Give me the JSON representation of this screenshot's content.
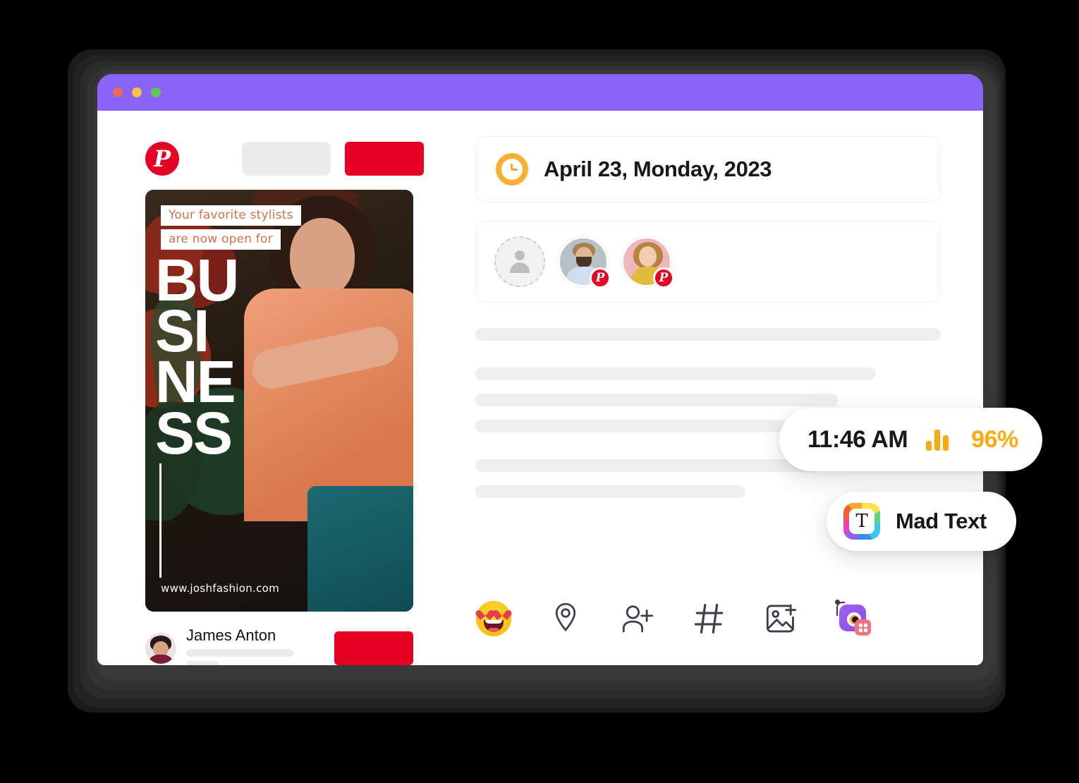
{
  "window": {
    "titlebar_color": "#8A64FA",
    "traffic_lights": [
      "close",
      "minimize",
      "maximize"
    ]
  },
  "left_panel": {
    "brand": {
      "icon": "pinterest-logo-icon",
      "glyph": "P"
    },
    "toolbar_buttons": [
      {
        "name": "search-placeholder-button",
        "color": "#ECECEC"
      },
      {
        "name": "primary-action-button",
        "color": "#E60023"
      }
    ],
    "poster": {
      "caption_line1": "Your favorite stylists",
      "caption_line2": "are now open for",
      "title_lines": [
        "BU",
        "SI",
        "NE",
        "SS"
      ],
      "url": "www.joshfashion.com",
      "caption_color": "#D4704F"
    },
    "author": {
      "name": "James Anton",
      "avatar": "author-avatar",
      "follow_button_color": "#E60023"
    }
  },
  "right_panel": {
    "date_card": {
      "icon": "clock-icon",
      "icon_color": "#FBB033",
      "text": "April 23, Monday, 2023"
    },
    "people_card": {
      "add_label": "add-person",
      "accounts": [
        {
          "name": "account-avatar-male",
          "platform": "pinterest",
          "badge_glyph": "P"
        },
        {
          "name": "account-avatar-female",
          "platform": "pinterest",
          "badge_glyph": "P"
        }
      ]
    },
    "skeleton_bars": [
      {
        "width": "100%",
        "gap": "0"
      },
      {
        "width": "86%",
        "gap": "lg"
      },
      {
        "width": "78%",
        "gap": "sm"
      },
      {
        "width": "84%",
        "gap": "sm"
      },
      {
        "width": "74%",
        "gap": "lg"
      },
      {
        "width": "58%",
        "gap": "sm"
      }
    ],
    "toolbar_icons": [
      {
        "name": "emoji-heart-eyes-icon",
        "label": "emoji"
      },
      {
        "name": "location-pin-icon",
        "label": "location"
      },
      {
        "name": "tag-person-icon",
        "label": "tag people"
      },
      {
        "name": "hashtag-icon",
        "label": "hashtag"
      },
      {
        "name": "add-image-icon",
        "label": "add image"
      },
      {
        "name": "camera-app-icon",
        "label": "camera"
      }
    ]
  },
  "floating_badges": {
    "time_badge": {
      "time": "11:46 AM",
      "percent": "96%",
      "accent_color": "#FBAB0C",
      "icon": "signal-bars-icon"
    },
    "text_badge": {
      "label": "Mad Text",
      "icon": "mad-text-app-icon",
      "icon_glyph": "T"
    }
  }
}
